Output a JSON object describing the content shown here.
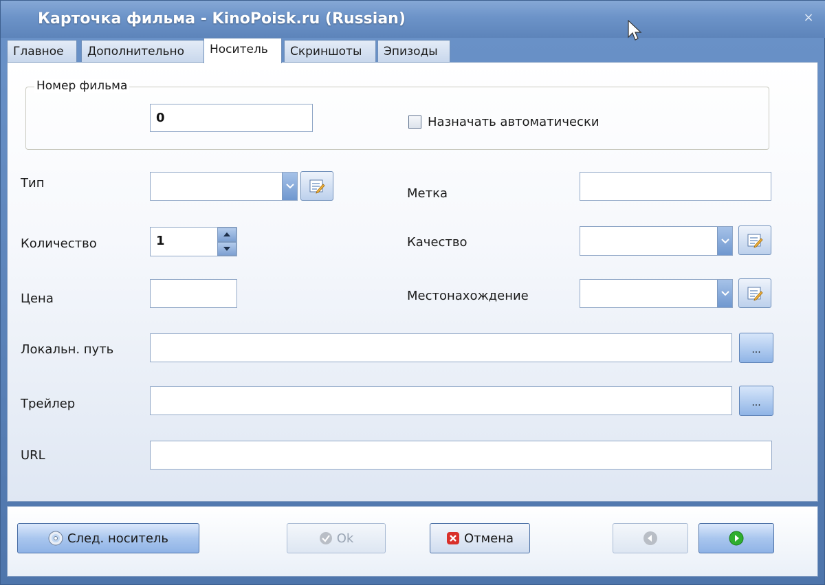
{
  "window": {
    "title": "Карточка фильма - KinoPoisk.ru (Russian)",
    "close_glyph": "×"
  },
  "tabs": [
    {
      "label": "Главное",
      "active": false
    },
    {
      "label": "Дополнительно",
      "active": false
    },
    {
      "label": "Носитель",
      "active": true
    },
    {
      "label": "Скриншоты",
      "active": false
    },
    {
      "label": "Эпизоды",
      "active": false
    }
  ],
  "movie_number": {
    "group_label": "Номер фильма",
    "value": "0",
    "auto_assign_label": "Назначать автоматически",
    "auto_assign_checked": false
  },
  "fields": {
    "type_label": "Тип",
    "type_value": "",
    "label_label": "Метка",
    "label_value": "",
    "quantity_label": "Количество",
    "quantity_value": "1",
    "quality_label": "Качество",
    "quality_value": "",
    "price_label": "Цена",
    "price_value": "",
    "location_label": "Местонахождение",
    "location_value": "",
    "local_path_label": "Локальн. путь",
    "local_path_value": "",
    "trailer_label": "Трейлер",
    "trailer_value": "",
    "url_label": "URL",
    "url_value": "",
    "browse_label": "..."
  },
  "footer": {
    "next_media_label": "След. носитель",
    "ok_label": "Ok",
    "cancel_label": "Отмена"
  },
  "colors": {
    "titlebar": "#6c93c8",
    "accent_blue": "#8fb3e6",
    "cancel_red": "#d9302a",
    "next_green": "#2fae2f"
  }
}
